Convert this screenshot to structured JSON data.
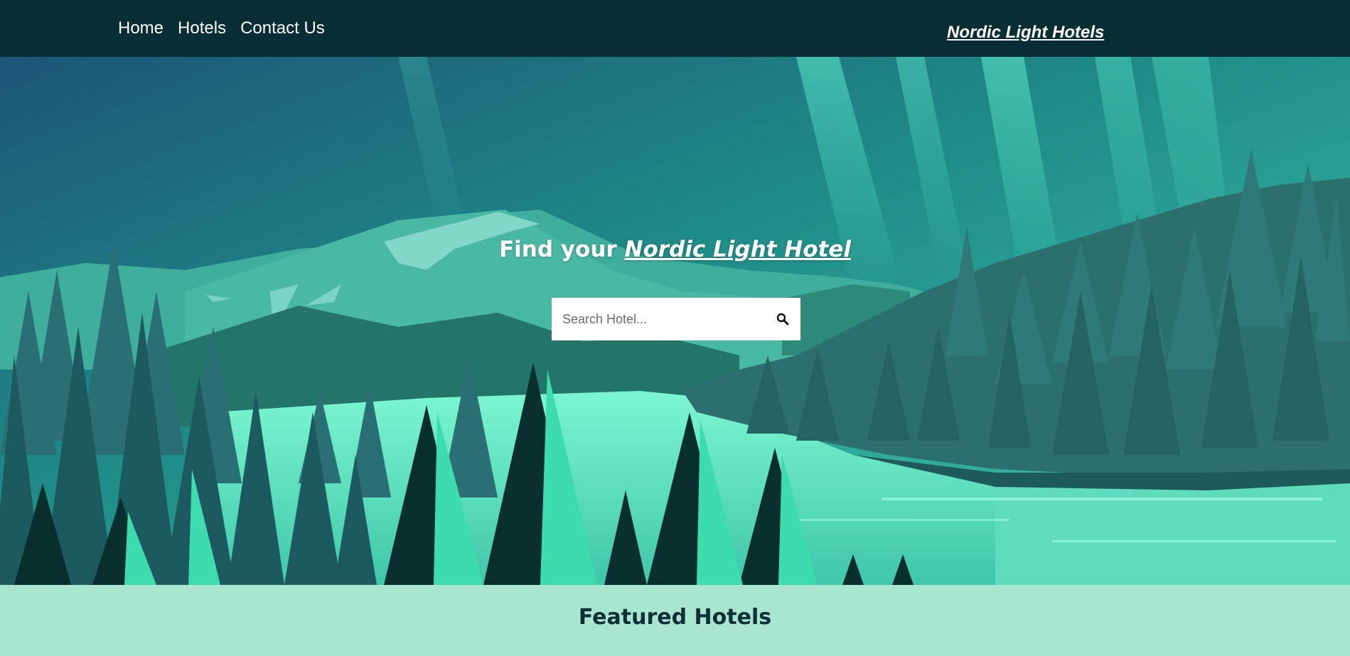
{
  "nav": {
    "links": [
      {
        "label": "Home"
      },
      {
        "label": "Hotels"
      },
      {
        "label": "Contact Us"
      }
    ],
    "brand": "Nordic Light Hotels"
  },
  "hero": {
    "title_prefix": "Find your ",
    "title_accent": "Nordic Light Hotel",
    "search": {
      "placeholder": "Search Hotel...",
      "value": "",
      "icon": "search-icon"
    }
  },
  "featured": {
    "title": "Featured Hotels"
  },
  "colors": {
    "nav_bg": "#082e33",
    "featured_bg": "#a8e6d0",
    "sky_top": "#1a5a7a",
    "aurora": "#3fd6b8",
    "lake": "#6df0c8",
    "dark_tree": "#082e2e"
  }
}
